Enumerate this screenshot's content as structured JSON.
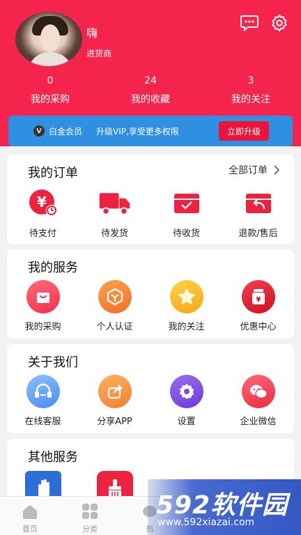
{
  "profile": {
    "name": "嗨",
    "role": "进货商"
  },
  "header_icons": [
    "chat-bubble-icon",
    "gear-icon"
  ],
  "stats": [
    {
      "count": "0",
      "label": "我的采购"
    },
    {
      "count": "24",
      "label": "我的收藏"
    },
    {
      "count": "3",
      "label": "我的关注"
    }
  ],
  "vip": {
    "badge": "V",
    "title": "白金会员",
    "description": "升级VIP,享受更多权限",
    "upgrade_label": "立即升级"
  },
  "orders": {
    "title": "我的订单",
    "all_label": "全部订单",
    "items": [
      {
        "label": "待支付",
        "icon": "pending-payment-icon"
      },
      {
        "label": "待发货",
        "icon": "delivery-truck-icon"
      },
      {
        "label": "待收货",
        "icon": "inbox-receive-icon"
      },
      {
        "label": "退款/售后",
        "icon": "refund-return-icon"
      }
    ]
  },
  "services": {
    "title": "我的服务",
    "items": [
      {
        "label": "我的采购",
        "icon": "shopping-bag-icon"
      },
      {
        "label": "个人认证",
        "icon": "verify-cube-icon"
      },
      {
        "label": "我的关注",
        "icon": "star-icon"
      },
      {
        "label": "优惠中心",
        "icon": "coupon-jar-icon"
      }
    ]
  },
  "about": {
    "title": "关于我们",
    "items": [
      {
        "label": "在线客服",
        "icon": "headset-icon"
      },
      {
        "label": "分享APP",
        "icon": "share-icon"
      },
      {
        "label": "设置",
        "icon": "settings-gear-icon"
      },
      {
        "label": "企业微信",
        "icon": "wechat-icon"
      }
    ]
  },
  "other": {
    "title": "其他服务",
    "items": [
      {
        "label": "",
        "icon": "hand-icon"
      },
      {
        "label": "",
        "icon": "broom-icon"
      }
    ]
  },
  "tabbar": [
    {
      "label": "首页",
      "icon": "home-icon"
    },
    {
      "label": "分类",
      "icon": "grid-icon"
    },
    {
      "label": "热",
      "icon": "hot-icon"
    }
  ],
  "watermark": {
    "main": "592软件园",
    "sub": "www.592xiazai.com"
  },
  "colors": {
    "brand_red": "#f4244c",
    "vip_blue": "#2f8fe0",
    "upgrade_red": "#e8143c"
  }
}
